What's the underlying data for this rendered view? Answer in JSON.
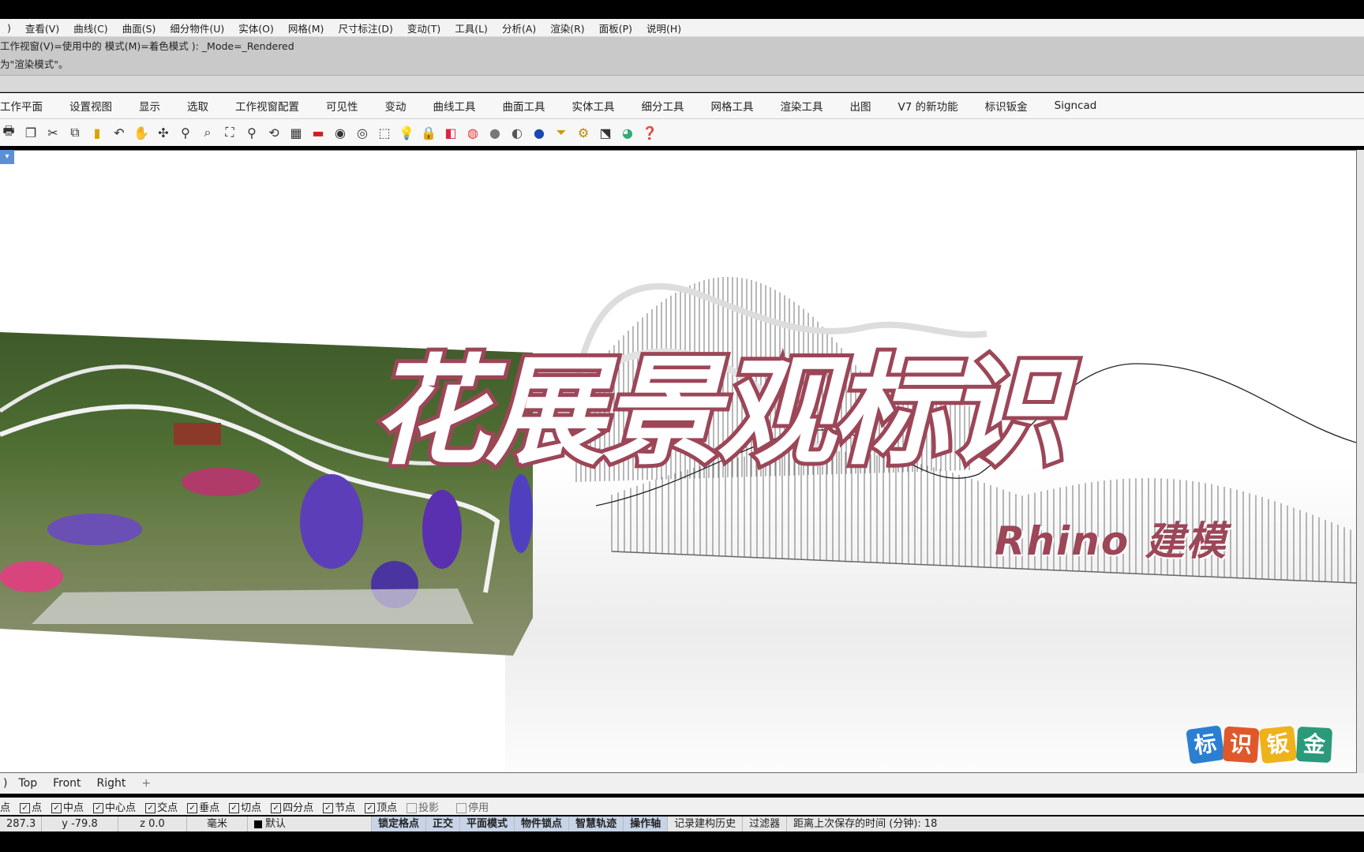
{
  "menu": [
    "查看(V)",
    "曲线(C)",
    "曲面(S)",
    "细分物件(U)",
    "实体(O)",
    "网格(M)",
    "尺寸标注(D)",
    "变动(T)",
    "工具(L)",
    "分析(A)",
    "渲染(R)",
    "面板(P)",
    "说明(H)"
  ],
  "command_history": {
    "line1": "工作视窗(V)=使用中的  模式(M)=着色模式 ): _Mode=_Rendered",
    "line2": "为\"渲染模式\"。"
  },
  "tabs": [
    "工作平面",
    "设置视图",
    "显示",
    "选取",
    "工作视窗配置",
    "可见性",
    "变动",
    "曲线工具",
    "曲面工具",
    "实体工具",
    "细分工具",
    "网格工具",
    "渲染工具",
    "出图",
    "V7 的新功能",
    "标识钣金",
    "Signcad"
  ],
  "toolbar_icons": [
    "print-icon",
    "copy-icon",
    "cut-icon",
    "duplicate-icon",
    "paste-icon",
    "undo-icon",
    "pan-hand-icon",
    "rotate-icon",
    "zoom-icon",
    "zoom-window-icon",
    "zoom-extents-icon",
    "zoom-selected-icon",
    "rotate-view-icon",
    "grid-icon",
    "car-icon",
    "eye-icon",
    "target-icon",
    "transform-icon",
    "lightbulb-icon",
    "lock-icon",
    "layer-icon",
    "color-wheel-icon",
    "sphere-grey-icon",
    "sphere-half-icon",
    "sphere-blue-icon",
    "filter-icon",
    "gear-icon",
    "arrange-icon",
    "globe-icon",
    "help-icon"
  ],
  "viewport": {
    "title": "花展景观标识",
    "subtitle": "Rhino  建模",
    "logo": [
      "标",
      "识",
      "钣",
      "金"
    ],
    "logo_colors": [
      "#2a7fd3",
      "#e0582a",
      "#eeb21a",
      "#2a9a7a"
    ],
    "title_stroke_color": "#9c4658"
  },
  "view_tabs": [
    "Top",
    "Front",
    "Right",
    "+"
  ],
  "osnaps": [
    {
      "label": "点",
      "checked": true
    },
    {
      "label": "中点",
      "checked": true
    },
    {
      "label": "中心点",
      "checked": true
    },
    {
      "label": "交点",
      "checked": true
    },
    {
      "label": "垂点",
      "checked": true
    },
    {
      "label": "切点",
      "checked": true
    },
    {
      "label": "四分点",
      "checked": true
    },
    {
      "label": "节点",
      "checked": true
    },
    {
      "label": "顶点",
      "checked": true
    },
    {
      "label": "投影",
      "checked": false
    },
    {
      "label": "停用",
      "checked": false
    }
  ],
  "osnap_prefix": "点",
  "status": {
    "x": "287.3",
    "y": "y -79.8",
    "z": "z 0.0",
    "unit": "毫米",
    "layer": "默认",
    "grid_snap": "锁定格点",
    "ortho": "正交",
    "planar": "平面模式",
    "osnap": "物件锁点",
    "smarttrack": "智慧轨迹",
    "gumball": "操作轴",
    "history": "记录建构历史",
    "filter": "过滤器",
    "save_time": "距离上次保存的时间 (分钟): 18"
  }
}
